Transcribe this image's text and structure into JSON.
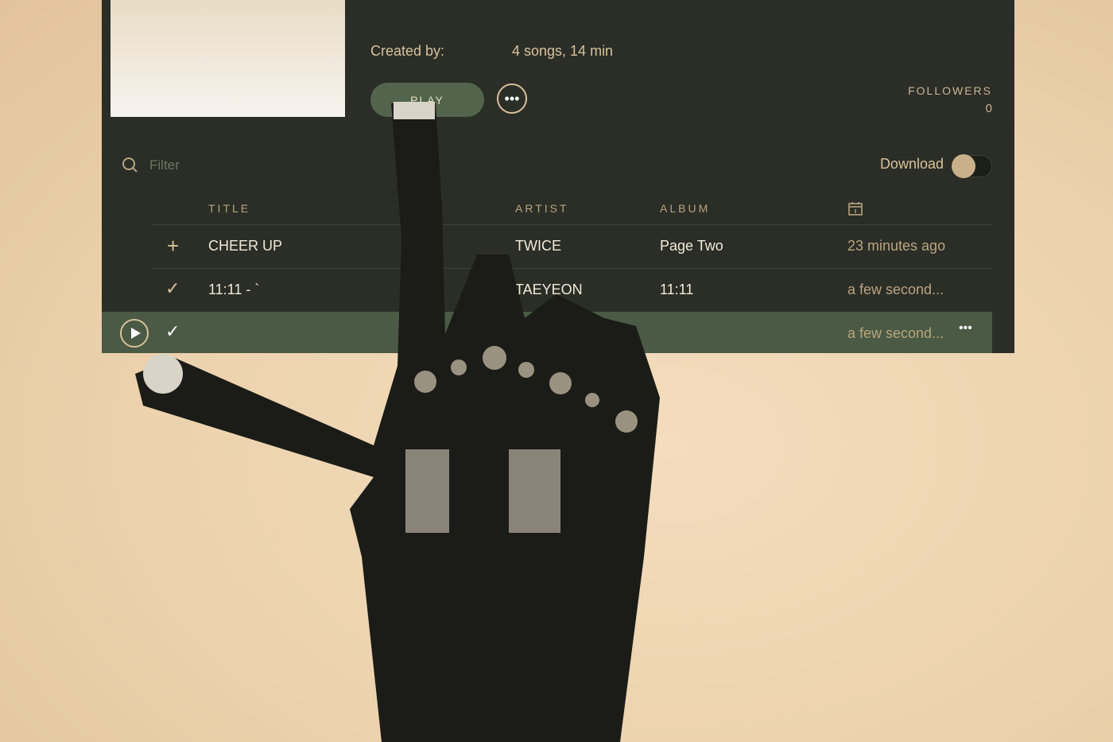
{
  "playlist": {
    "created_by_label": "Created by:",
    "summary": "4 songs, 14 min",
    "play_label": "PLAY",
    "more_icon": "ellipsis-icon"
  },
  "followers": {
    "label": "FOLLOWERS",
    "count": "0"
  },
  "filter": {
    "placeholder": "Filter"
  },
  "download": {
    "label": "Download",
    "enabled": false
  },
  "columns": {
    "title": "TITLE",
    "artist": "ARTIST",
    "album": "ALBUM",
    "date_icon": "calendar-icon"
  },
  "tracks": [
    {
      "action_icon": "plus-icon",
      "title": "CHEER UP",
      "artist": "TWICE",
      "album": "Page Two",
      "added": "23 minutes ago"
    },
    {
      "action_icon": "check-icon",
      "title": "11:11 - `",
      "artist": "TAEYEON",
      "album": "11:11",
      "added": "a few second..."
    },
    {
      "action_icon": "check-icon",
      "title": "",
      "artist": "",
      "album": "",
      "added": "a few second..."
    }
  ],
  "colors": {
    "panel": "#2b2d27",
    "accent": "#52654c",
    "text": "#d8c29c",
    "background": "#ecd2ad"
  }
}
